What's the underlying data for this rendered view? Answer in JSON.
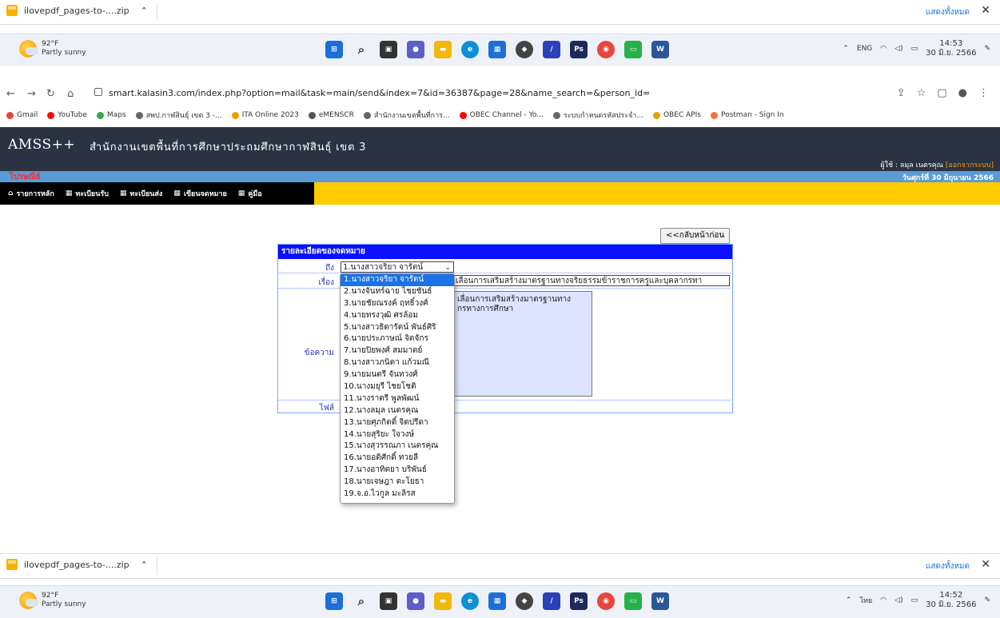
{
  "downloads": {
    "file": "ilovepdf_pages-to-....zip",
    "show_all": "แสดงทั้งหมด"
  },
  "weather": {
    "temp": "92°F",
    "desc": "Partly sunny"
  },
  "tray_top": {
    "lang": "ENG",
    "time": "14:53",
    "date": "30 มิ.ย. 2566"
  },
  "tray_bottom": {
    "lang": "ไทย",
    "time": "14:52",
    "date": "30 มิ.ย. 2566"
  },
  "browser": {
    "url": "smart.kalasin3.com/index.php?option=mail&task=main/send&index=7&id=36387&page=28&name_search=&person_id=",
    "bookmarks": [
      "Gmail",
      "YouTube",
      "Maps",
      "สพป.กาฬสินธุ์ เขต 3 -...",
      "ITA Online 2023",
      "eMENSCR",
      "สำนักงานเขตพื้นที่การ...",
      "OBEC Channel - Yo...",
      "ระบบกำหนดรหัสประจำ...",
      "OBEC APIs",
      "Postman - Sign In"
    ]
  },
  "site": {
    "logo": "AMSS++",
    "title": "สำนักงานเขตพื้นที่การศึกษาประถมศึกษากาฬสินธุ์ เขต 3",
    "user_label": "ผู้ใช้ : ลมุล  เนตรคุณ",
    "logout": "[ออกจากระบบ]",
    "section": "ไปรษณีย์",
    "date": "วันศุกร์ที่ 30 มิถุนายน 2566",
    "menu": [
      "รายการหลัก",
      "ทะเบียนรับ",
      "ทะเบียนส่ง",
      "เขียนจดหมาย",
      "คู่มือ"
    ]
  },
  "form": {
    "back": "<<กลับหน้าก่อน",
    "header": "รายละเอียดของจดหมาย",
    "to_label": "ถึง",
    "subject_label": "เรื่อง",
    "message_label": "ข้อความ",
    "file_label": "ไฟล์",
    "selected": "1.นางสาวจริยา  จารัตน์",
    "subject_value": "เลื่อนการเสริมสร้างมาตรฐานทางจริยธรรมข้าราชการครูและบุคลากรทา",
    "message_value": "เลื่อนการเสริมสร้างมาตรฐานทาง\nกรทางการศึกษา"
  },
  "dropdown_options": [
    "1.นางสาวจริยา  จารัตน์",
    "2.นางจันทร์ฉาย  ไชยชันธ์",
    "3.นายชัยณรงค์  ฤทธิ์วงศ์",
    "4.นายทรงวุฒิ  ศรล้อม",
    "5.นางสาวธิดารัตน์  พันธ์ศิริ",
    "6.นายประภาษณ์  จิตจักร",
    "7.นายปิยพงศ์  สมมาตย์",
    "8.นางสาวภนิตา  แก้วมณี",
    "9.นายมนตรี  จันทวงศ์",
    "10.นางมยุรี  ไชยโชติ",
    "11.นางราตรี  พูลพัฒน์",
    "12.นางลมุล   เนตรคุณ",
    "13.นายศุภกิตติ์  จิตปรีดา",
    "14.นายสุริยะ  ใจวงษ์",
    "15.นางสุวรรณภา  เนตรคุณ",
    "16.นายอดิศักดิ์  ทวยลี",
    "17.นางอาทิตยา  บริพันธ์",
    "18.นายเจษฎา  ตะโยธา",
    "19.จ.อ.ไวกูล  มะลิรส"
  ]
}
